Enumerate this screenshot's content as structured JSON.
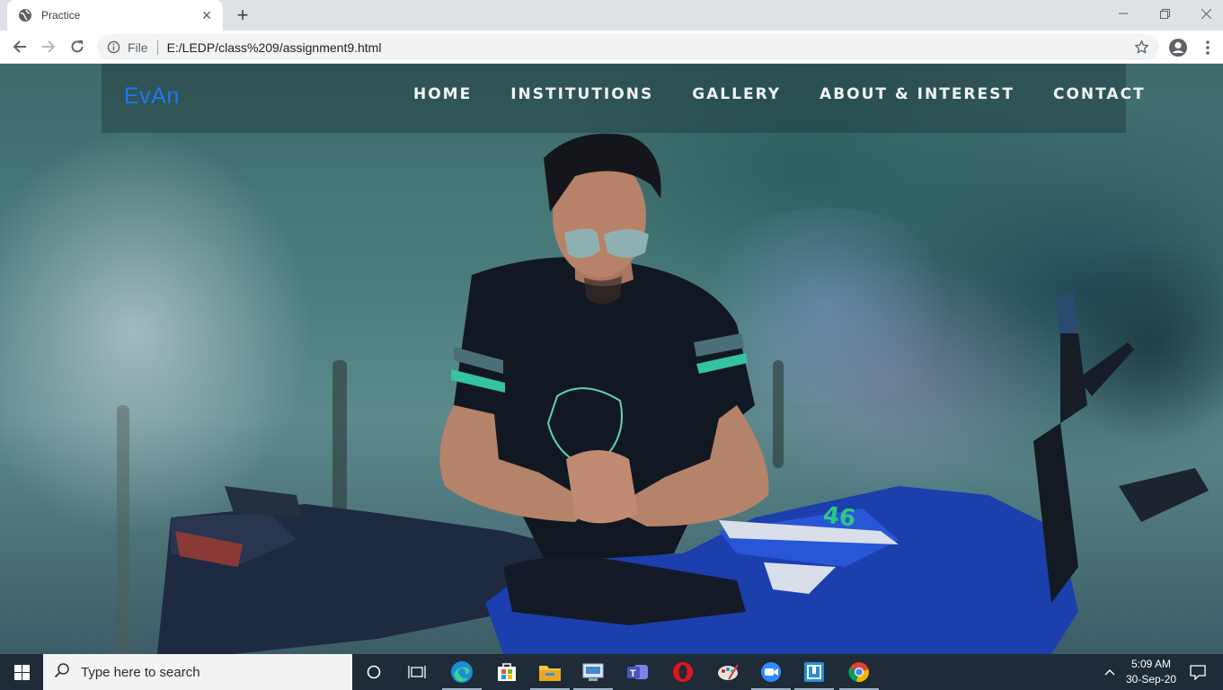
{
  "browser": {
    "tab_title": "Practice",
    "scheme": "File",
    "url": "E:/LEDP/class%209/assignment9.html"
  },
  "site": {
    "brand": "EvAn",
    "menu": [
      "HOME",
      "INSTITUTIONS",
      "GALLERY",
      "ABOUT & INTEREST",
      "CONTACT"
    ]
  },
  "taskbar": {
    "search_placeholder": "Type here to search",
    "time": "5:09 AM",
    "date": "30-Sep-20",
    "pinned": [
      "cortana-icon",
      "task-view-icon",
      "edge-icon",
      "store-icon",
      "file-explorer-icon",
      "network-app-icon",
      "teams-icon",
      "opera-icon",
      "paint-app-icon",
      "zoom-icon",
      "app-icon",
      "chrome-icon"
    ]
  },
  "colors": {
    "brand": "#1a7bf0",
    "taskbar": "#1f2b36"
  }
}
